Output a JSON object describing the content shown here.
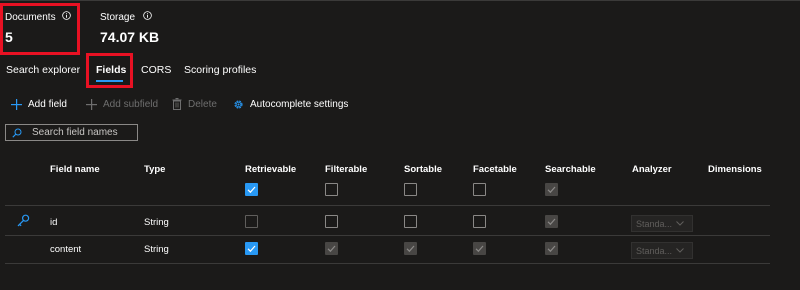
{
  "stats": {
    "documents": {
      "label": "Documents",
      "value": "5"
    },
    "storage": {
      "label": "Storage",
      "value": "74.07 KB"
    }
  },
  "tabs": [
    {
      "label": "Search explorer",
      "active": false
    },
    {
      "label": "Fields",
      "active": true
    },
    {
      "label": "CORS",
      "active": false
    },
    {
      "label": "Scoring profiles",
      "active": false
    }
  ],
  "toolbar": {
    "add_field": "Add field",
    "add_subfield": "Add subfield",
    "delete": "Delete",
    "autocomplete": "Autocomplete settings"
  },
  "search": {
    "placeholder": "Search field names",
    "value": ""
  },
  "columns": {
    "field_name": "Field name",
    "type": "Type",
    "retrievable": "Retrievable",
    "filterable": "Filterable",
    "sortable": "Sortable",
    "facetable": "Facetable",
    "searchable": "Searchable",
    "analyzer": "Analyzer",
    "dimensions": "Dimensions"
  },
  "header_checks": {
    "retrievable": true,
    "filterable": false,
    "sortable": false,
    "facetable": false,
    "searchable": true
  },
  "rows": [
    {
      "key_icon": "key-icon",
      "name": "id",
      "type": "String",
      "retrievable": false,
      "filterable": false,
      "sortable": false,
      "facetable": false,
      "searchable": true,
      "analyzer": "Standa..."
    },
    {
      "key_icon": "",
      "name": "content",
      "type": "String",
      "retrievable": true,
      "filterable": true,
      "sortable": true,
      "facetable": true,
      "searchable": true,
      "analyzer": "Standa..."
    }
  ],
  "colors": {
    "background": "#1b1a19",
    "accent": "#2899f5",
    "highlight_box": "#e81123"
  }
}
